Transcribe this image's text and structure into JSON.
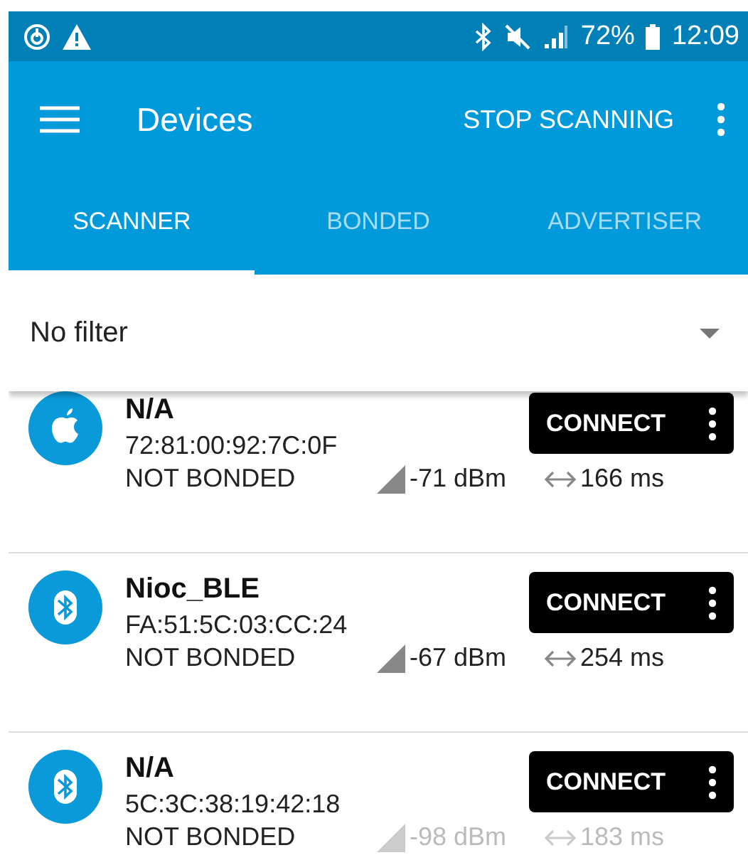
{
  "status_bar": {
    "battery": "72%",
    "time": "12:09"
  },
  "toolbar": {
    "title": "Devices",
    "action": "STOP SCANNING"
  },
  "tabs": [
    {
      "label": "SCANNER",
      "selected": true
    },
    {
      "label": "BONDED",
      "selected": false
    },
    {
      "label": "ADVERTISER",
      "selected": false
    }
  ],
  "filter": {
    "value": "No filter"
  },
  "devices": [
    {
      "kind": "apple",
      "name": "N/A",
      "address": "72:81:00:92:7C:0F",
      "bond": "NOT BONDED",
      "rssi": "-71 dBm",
      "interval": "166 ms",
      "faded": false,
      "button": "CONNECT"
    },
    {
      "kind": "bluetooth",
      "name": "Nioc_BLE",
      "address": "FA:51:5C:03:CC:24",
      "bond": "NOT BONDED",
      "rssi": "-67 dBm",
      "interval": "254 ms",
      "faded": false,
      "button": "CONNECT"
    },
    {
      "kind": "bluetooth",
      "name": "N/A",
      "address": "5C:3C:38:19:42:18",
      "bond": "NOT BONDED",
      "rssi": "-98 dBm",
      "interval": "183 ms",
      "faded": true,
      "button": "CONNECT"
    }
  ]
}
